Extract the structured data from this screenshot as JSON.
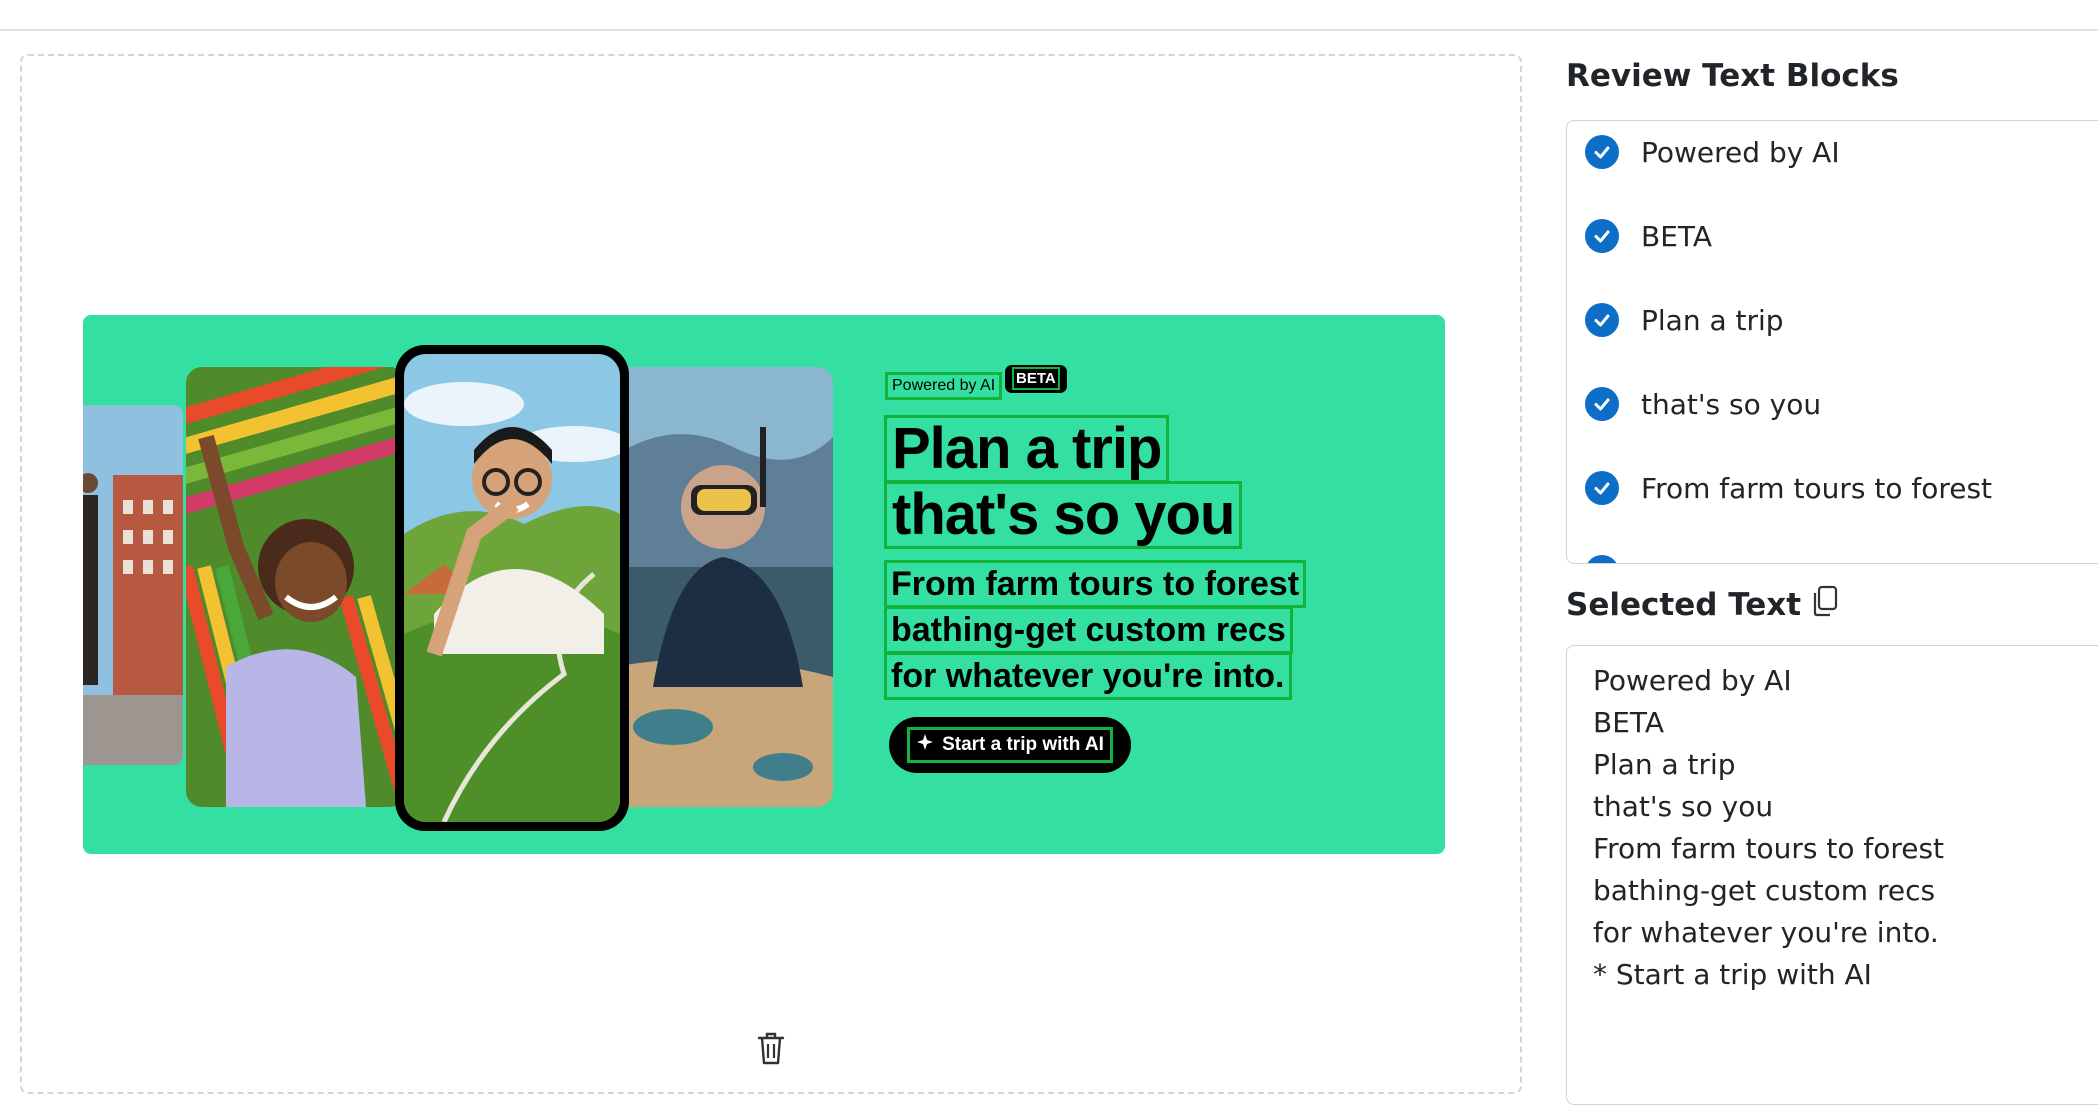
{
  "banner": {
    "powered_by": "Powered by AI",
    "beta": "BETA",
    "headline": [
      "Plan a trip",
      "that's so you"
    ],
    "subtext": [
      "From farm tours to forest",
      "bathing-get custom recs",
      "for whatever you're into."
    ],
    "cta_label": "Start a trip with AI",
    "background_color": "#34e0a1",
    "highlight_color": "#12b23c"
  },
  "review": {
    "title": "Review Text Blocks",
    "items": [
      {
        "label": "Powered by AI",
        "checked": true
      },
      {
        "label": "BETA",
        "checked": true
      },
      {
        "label": "Plan a trip",
        "checked": true
      },
      {
        "label": "that's so you",
        "checked": true
      },
      {
        "label": "From farm tours to forest",
        "checked": true
      }
    ]
  },
  "selected": {
    "title": "Selected Text",
    "copy_icon": "copy-icon",
    "lines": [
      "Powered by AI",
      "BETA",
      "Plan a trip",
      "that's so you",
      "From farm tours to forest",
      "bathing-get custom recs",
      "for whatever you're into.",
      "* Start a trip with AI"
    ]
  },
  "icons": {
    "delete": "trash-icon",
    "check": "check-circle-icon",
    "sparkle": "sparkle-icon"
  },
  "accent_color": "#0d6ec7"
}
